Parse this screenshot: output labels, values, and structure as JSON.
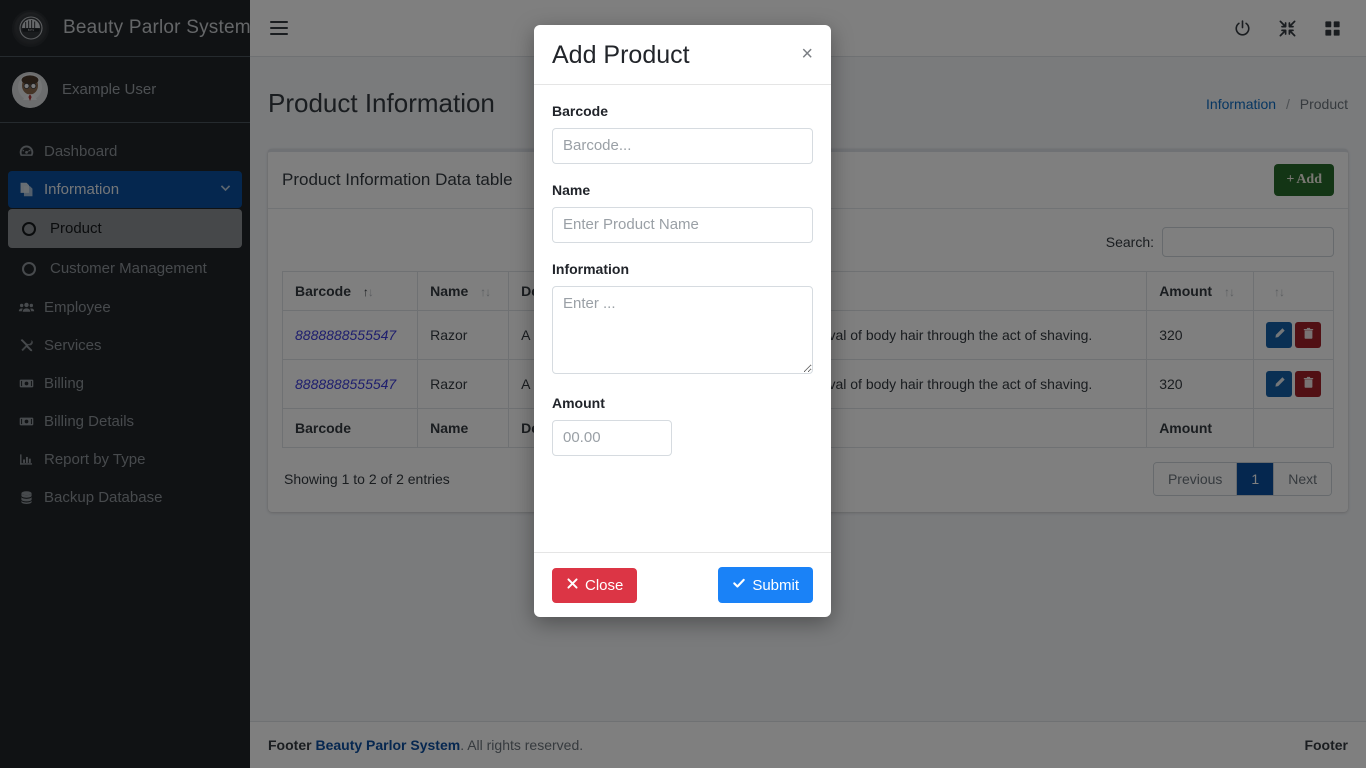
{
  "sidebar": {
    "brand": "Beauty Parlor System",
    "brand_logo_icon": "parlor-logo-icon",
    "user": {
      "name": "Example User",
      "avatar_icon": "user-avatar-icon"
    },
    "items": [
      {
        "label": "Dashboard",
        "icon": "tachometer-icon",
        "active": false
      },
      {
        "label": "Information",
        "icon": "copy-files-icon",
        "active": true,
        "chevron": "chevron-down-icon"
      },
      {
        "label": "Employee",
        "icon": "users-icon",
        "active": false
      },
      {
        "label": "Services",
        "icon": "tools-icon",
        "active": false
      },
      {
        "label": "Billing",
        "icon": "money-bill-icon",
        "active": false
      },
      {
        "label": "Billing Details",
        "icon": "money-bill-icon",
        "active": false
      },
      {
        "label": "Report by Type",
        "icon": "chart-bar-icon",
        "active": false
      },
      {
        "label": "Backup Database",
        "icon": "database-icon",
        "active": false
      }
    ],
    "subitems": [
      {
        "label": "Product",
        "selected": true
      },
      {
        "label": "Customer Management",
        "selected": false
      }
    ]
  },
  "topbar": {
    "menu_icon": "hamburger-icon",
    "icons": [
      {
        "name": "power-icon"
      },
      {
        "name": "compress-arrows-icon"
      },
      {
        "name": "grid-apps-icon"
      }
    ]
  },
  "page": {
    "title": "Product Information",
    "breadcrumb": {
      "link": "Information",
      "separator": "/",
      "current": "Product"
    }
  },
  "card": {
    "title": "Product Information Data table",
    "add_button": {
      "plus": "+",
      "label": "Add",
      "color": "#276b2b"
    }
  },
  "table": {
    "search_label": "Search:",
    "search_value": "",
    "search_placeholder": "",
    "columns": [
      {
        "label": "Barcode",
        "sort": "asc"
      },
      {
        "label": "Name",
        "sort": "none"
      },
      {
        "label": "Description",
        "sort": "none"
      },
      {
        "label": "Amount",
        "sort": "none"
      },
      {
        "label": "",
        "sort": "none"
      }
    ],
    "rows": [
      {
        "barcode": "8888888555547",
        "name": "Razor",
        "description": "A razor is a bladed tool primarily used in the removal of body hair through the act of shaving.",
        "amount": "320",
        "edit_icon": "pencil-icon",
        "delete_icon": "trash-icon"
      },
      {
        "barcode": "8888888555547",
        "name": "Razor",
        "description": "A razor is a bladed tool primarily used in the removal of body hair through the act of shaving.",
        "amount": "320",
        "edit_icon": "pencil-icon",
        "delete_icon": "trash-icon"
      }
    ],
    "info": "Showing 1 to 2 of 2 entries",
    "pagination": {
      "previous": "Previous",
      "pages": [
        "1"
      ],
      "current": "1",
      "next": "Next"
    }
  },
  "modal": {
    "title": "Add Product",
    "close_icon": "close-x-icon",
    "fields": {
      "barcode": {
        "label": "Barcode",
        "placeholder": "Barcode...",
        "value": ""
      },
      "name": {
        "label": "Name",
        "placeholder": "Enter Product Name",
        "value": ""
      },
      "information": {
        "label": "Information",
        "placeholder": "Enter ...",
        "value": ""
      },
      "amount": {
        "label": "Amount",
        "placeholder": "00.00",
        "value": ""
      }
    },
    "buttons": {
      "close": {
        "label": "Close",
        "icon": "times-icon",
        "color": "#dc3545"
      },
      "submit": {
        "label": "Submit",
        "icon": "check-icon",
        "color": "#1a82f7"
      }
    }
  },
  "footer": {
    "prefix": "Footer",
    "brand": "Beauty Parlor System",
    "suffix": ". All rights reserved.",
    "right": "Footer"
  }
}
